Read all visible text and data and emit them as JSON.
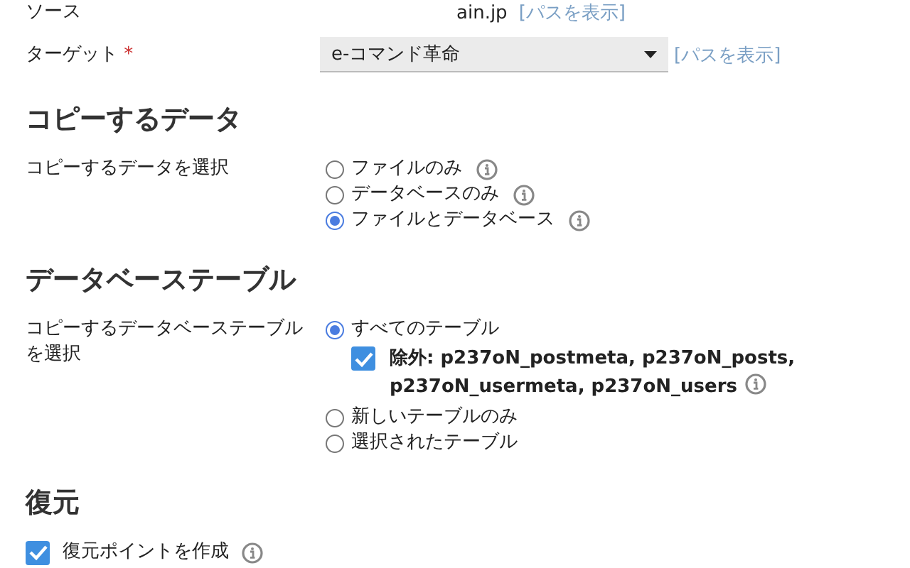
{
  "source": {
    "label": "ソース",
    "value": "ain.jp",
    "link": "[パスを表示]"
  },
  "target": {
    "label": "ターゲット",
    "required_mark": "*",
    "value": "e-コマンド革命",
    "link": "[パスを表示]"
  },
  "copy_data": {
    "heading": "コピーするデータ",
    "label": "コピーするデータを選択",
    "options": [
      {
        "label": "ファイルのみ",
        "selected": false
      },
      {
        "label": "データベースのみ",
        "selected": false
      },
      {
        "label": "ファイルとデータベース",
        "selected": true
      }
    ]
  },
  "db_tables": {
    "heading": "データベーステーブル",
    "label": "コピーするデータベーステーブルを選択",
    "options": [
      {
        "label": "すべてのテーブル",
        "selected": true,
        "exclude": {
          "checked": true,
          "text": "除外: p237oN_postmeta, p237oN_posts, p237oN_usermeta, p237oN_users"
        }
      },
      {
        "label": "新しいテーブルのみ",
        "selected": false
      },
      {
        "label": "選択されたテーブル",
        "selected": false
      }
    ]
  },
  "restore": {
    "heading": "復元",
    "checkbox": {
      "label": "復元ポイントを作成",
      "checked": true
    }
  }
}
